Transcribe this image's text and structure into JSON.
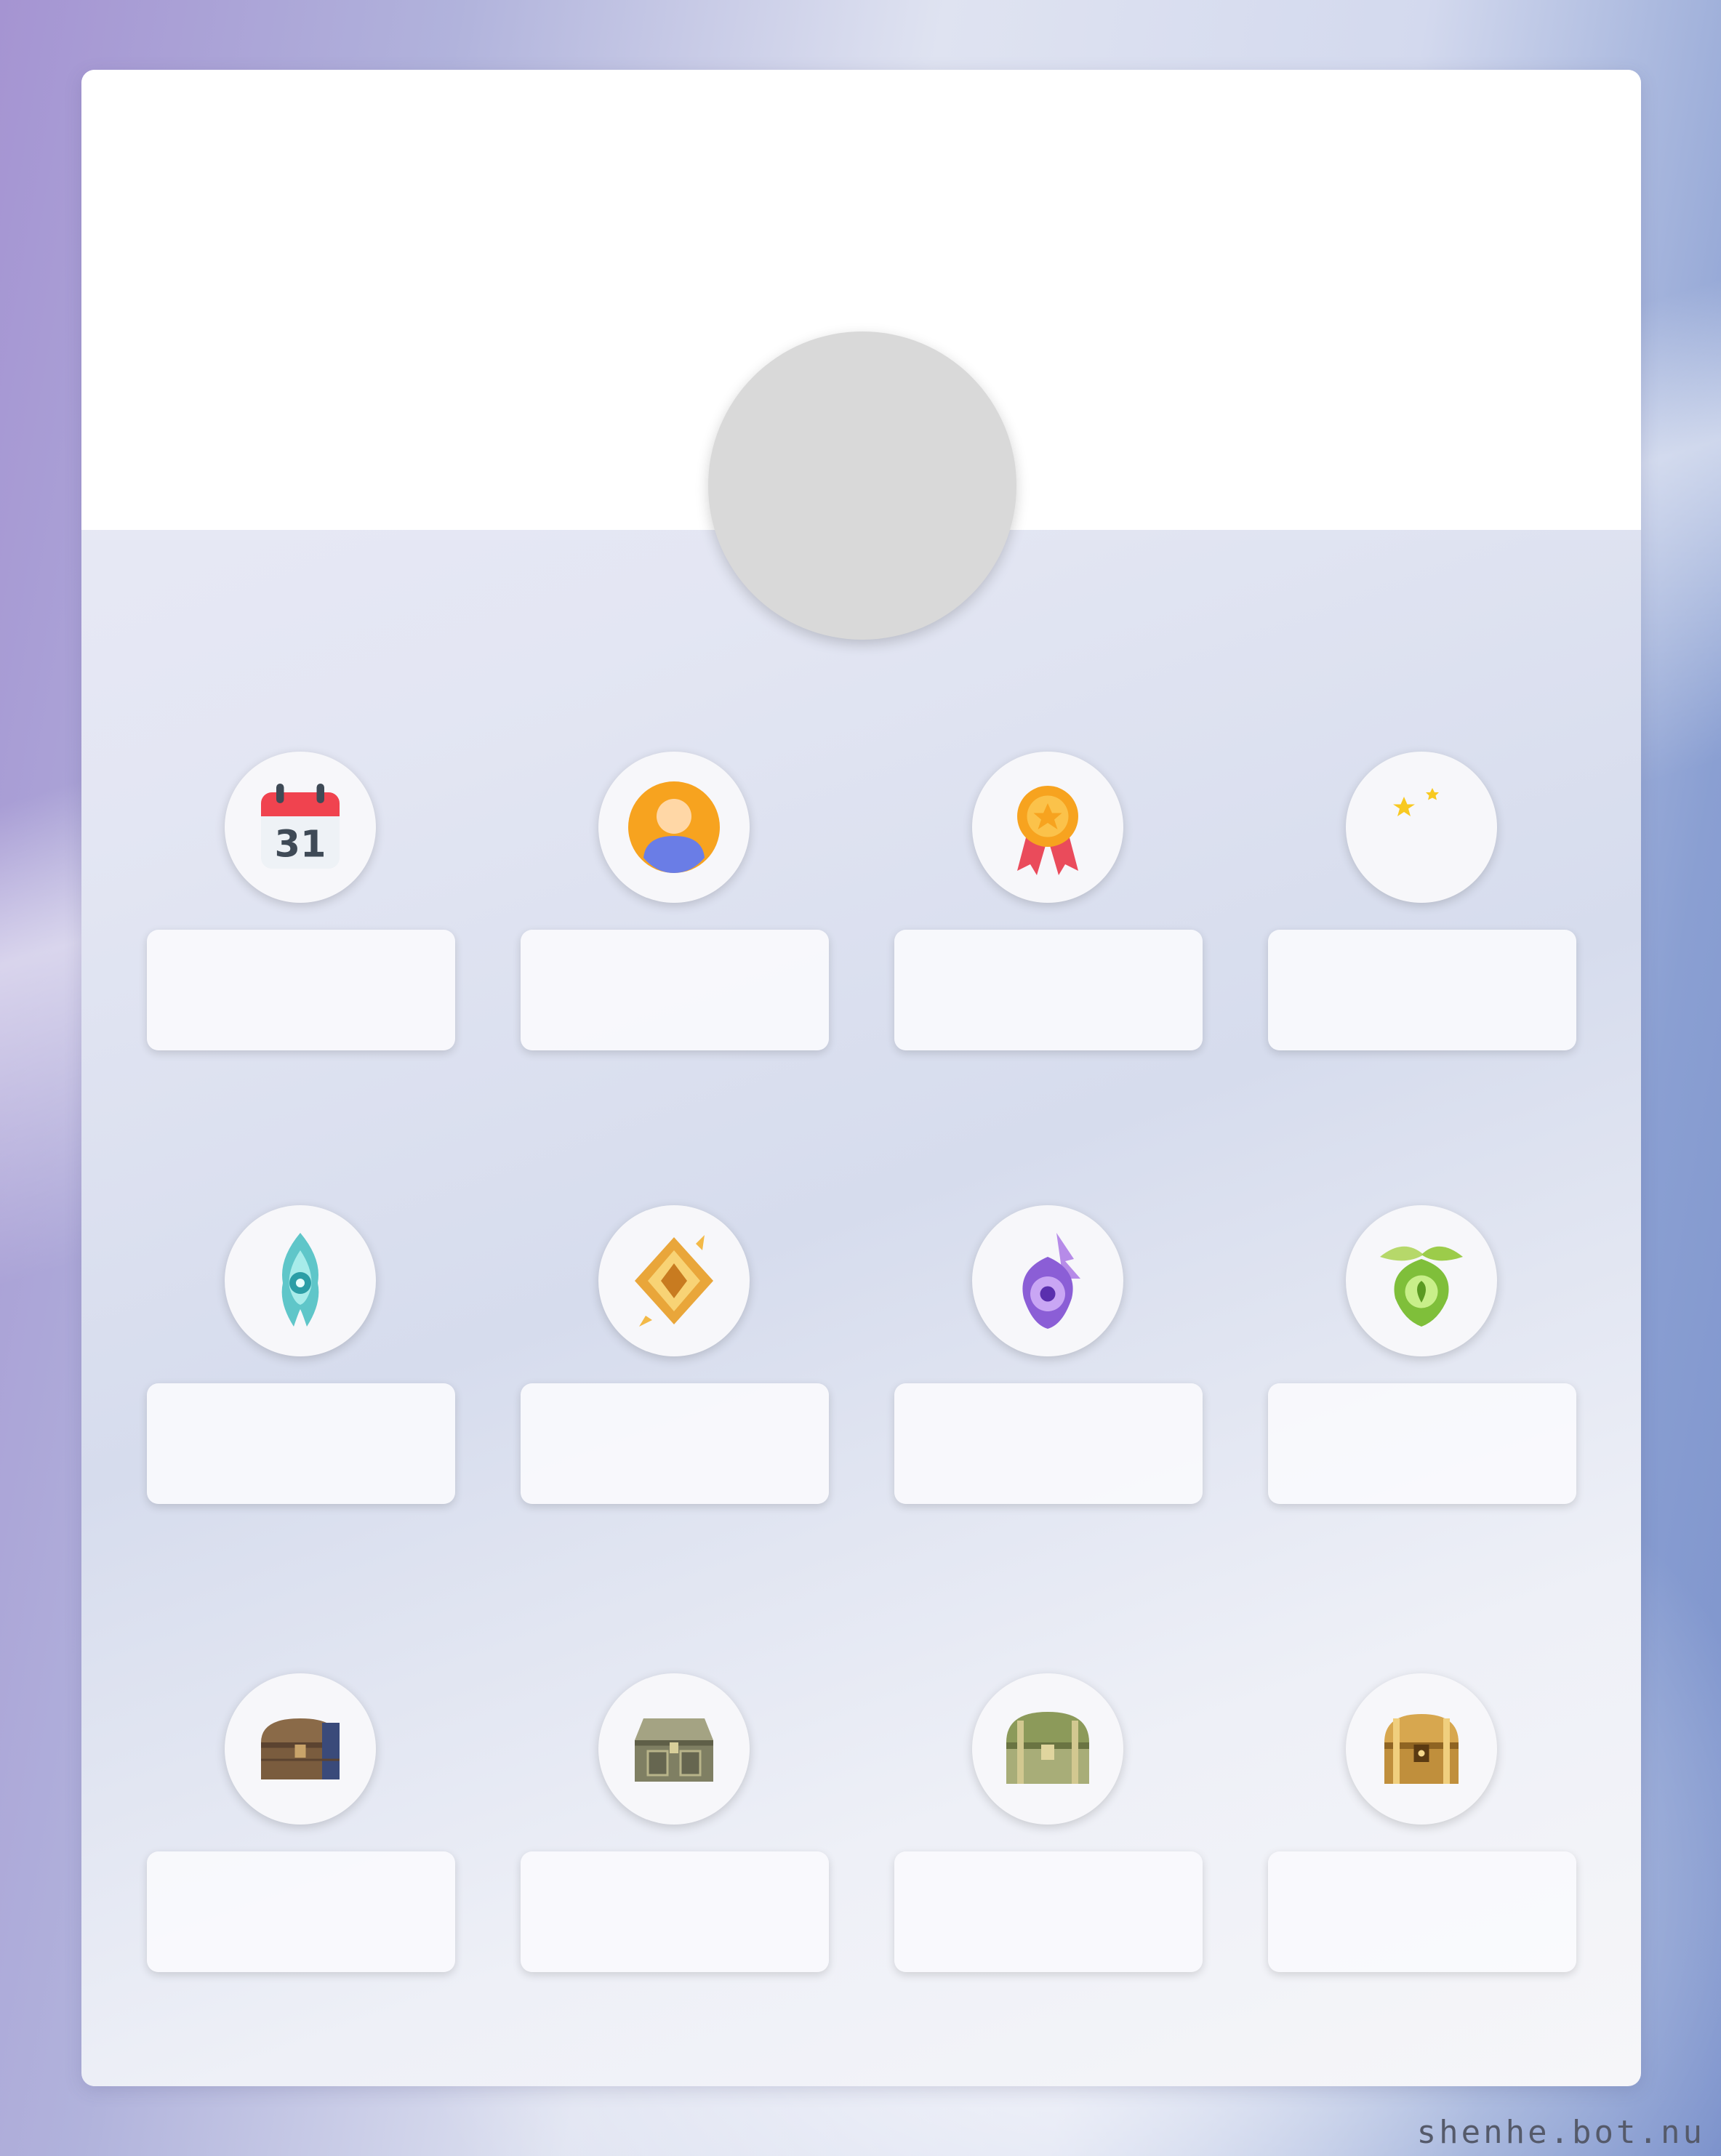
{
  "profile": {
    "banner_color": "#ffffff",
    "avatar_color": "#d9d9d9"
  },
  "stats": [
    {
      "icon": "calendar-icon",
      "value": ""
    },
    {
      "icon": "user-icon",
      "value": ""
    },
    {
      "icon": "medal-icon",
      "value": ""
    },
    {
      "icon": "moon-icon",
      "value": ""
    },
    {
      "icon": "anemoculus-icon",
      "value": ""
    },
    {
      "icon": "geoculus-icon",
      "value": ""
    },
    {
      "icon": "electroculus-icon",
      "value": ""
    },
    {
      "icon": "dendroculus-icon",
      "value": ""
    },
    {
      "icon": "common-chest-icon",
      "value": ""
    },
    {
      "icon": "exquisite-chest-icon",
      "value": ""
    },
    {
      "icon": "precious-chest-icon",
      "value": ""
    },
    {
      "icon": "luxurious-chest-icon",
      "value": ""
    }
  ],
  "footer": {
    "watermark": "shenhe.bot.nu"
  }
}
